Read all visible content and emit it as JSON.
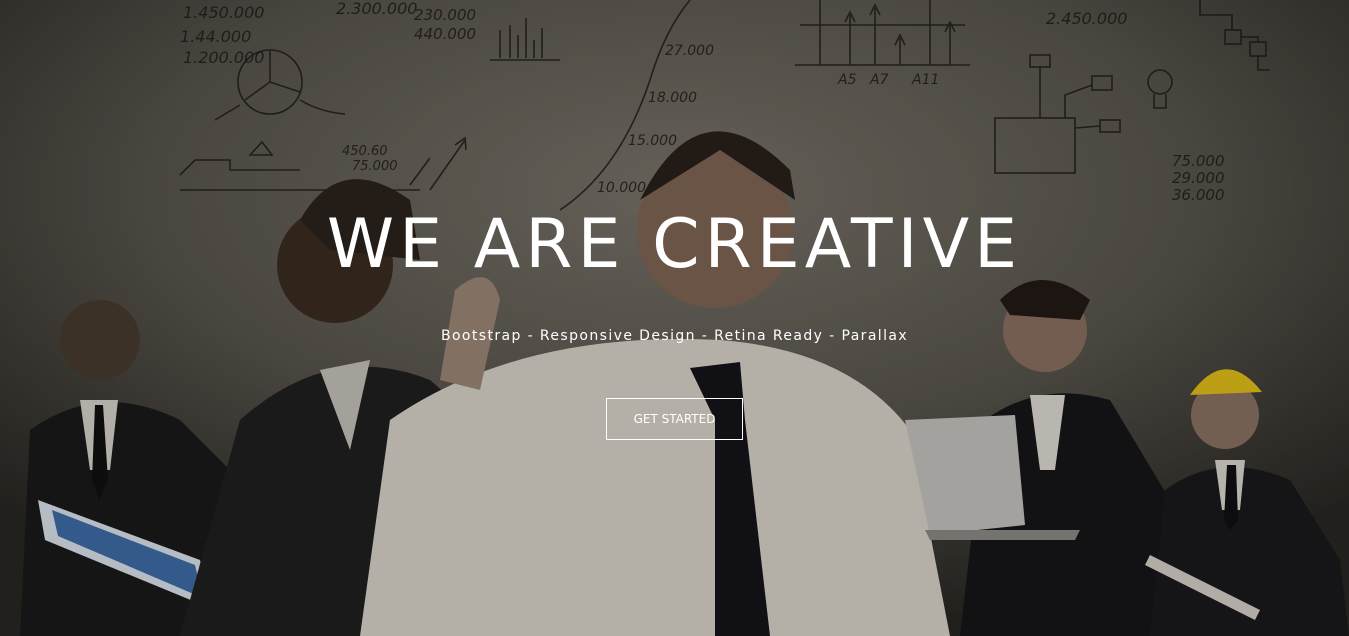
{
  "hero": {
    "title": "WE ARE CREATIVE",
    "subtitle": "Bootstrap - Responsive Design - Retina Ready - Parallax",
    "cta_label": "GET STARTED"
  },
  "background": {
    "sketch_texts": [
      "1.450.000",
      "1.44.000",
      "1.200.000",
      "2.300.000",
      "230.000",
      "440.000",
      "27.000",
      "18.000",
      "15.000",
      "10.000",
      "A5",
      "A7",
      "A11",
      "2.450.000",
      "75.000",
      "29.000",
      "36.000",
      "450.60",
      "75.000"
    ],
    "colors": {
      "wall": "#56524b",
      "ink": "#1e1c19",
      "text": "#ffffff"
    }
  }
}
